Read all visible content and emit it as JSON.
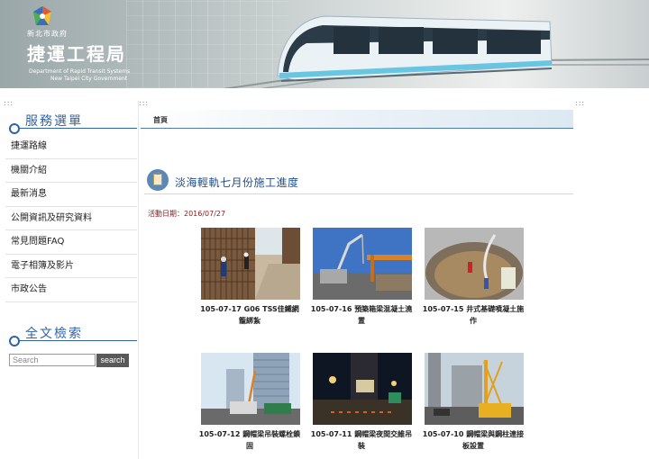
{
  "banner": {
    "city_label": "新北市政府",
    "bureau_name": "捷運工程局",
    "en_line1": "Department of Rapid Transit Systems",
    "en_line2": "New Taipei City Government"
  },
  "sidebar": {
    "service_title": "服務選單",
    "items": [
      {
        "label": "捷運路線"
      },
      {
        "label": "機關介紹"
      },
      {
        "label": "最新消息"
      },
      {
        "label": "公開資訊及研究資料"
      },
      {
        "label": "常見問題FAQ"
      },
      {
        "label": "電子相簿及影片"
      },
      {
        "label": "市政公告"
      }
    ],
    "search_title": "全文檢索",
    "search_placeholder": "Search",
    "search_button": "search"
  },
  "decor": {
    "dots": ":::"
  },
  "breadcrumb": {
    "home": "首頁"
  },
  "article": {
    "title": "淡海輕軌七月份施工進度",
    "date_label": "活動日期：",
    "date": "2016/07/27"
  },
  "photos": [
    {
      "line1": "105-07-17 G06 TSS佳鐵網",
      "line2": "籠綁紮"
    },
    {
      "line1": "105-07-16 預築箱梁混凝土澆",
      "line2": "置"
    },
    {
      "line1": "105-07-15 井式基礎噴凝土施",
      "line2": "作"
    },
    {
      "line1": "105-07-12 鋼帽梁吊裝螺栓鎖",
      "line2": "固"
    },
    {
      "line1": "105-07-11 鋼帽梁夜間交維吊",
      "line2": "裝"
    },
    {
      "line1": "105-07-10 鋼帽梁與鋼柱連接",
      "line2": "板設置"
    }
  ]
}
